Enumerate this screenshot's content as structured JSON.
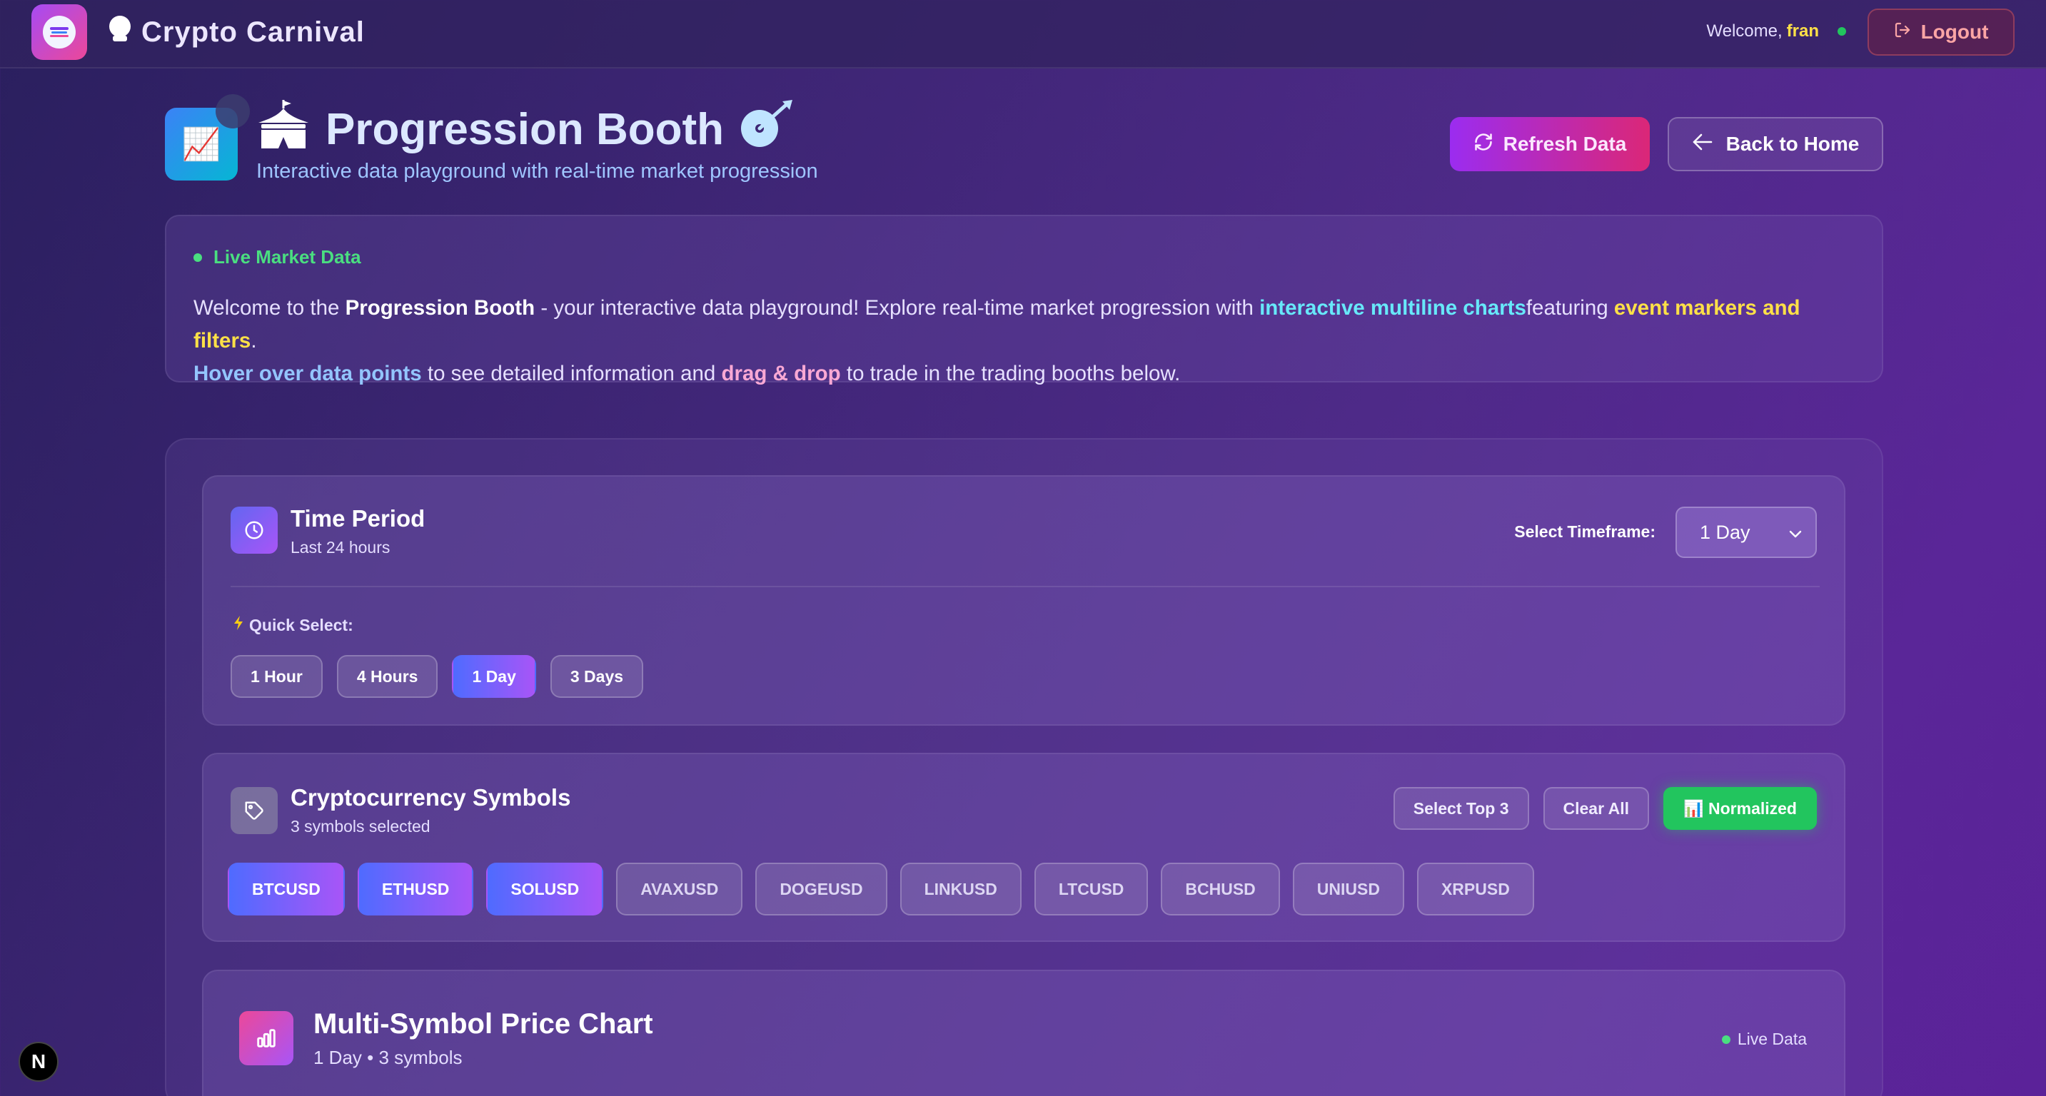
{
  "header": {
    "app_title": "Crypto Carnival",
    "welcome_prefix": "Welcome,",
    "username": "fran",
    "logout_label": "Logout"
  },
  "page": {
    "icon_emoji": "📈",
    "title": "Progression Booth",
    "subtitle": "Interactive data playground with real-time market progression",
    "refresh_label": "Refresh Data",
    "home_label": "Back to Home"
  },
  "intro": {
    "live_label": "Live Market Data",
    "seg1": "Welcome to the ",
    "seg2": "Progression Booth",
    "seg3": " - your interactive data playground! Explore real-time market progression with ",
    "seg4": "interactive multiline charts",
    "seg5": "featuring ",
    "seg6": "event markers and filters",
    "seg7": ". ",
    "seg8": "Hover over data points",
    "seg9": " to see detailed information and ",
    "seg10": "drag & drop",
    "seg11": " to trade in the trading booths below."
  },
  "time_period": {
    "title": "Time Period",
    "subtitle": "Last 24 hours",
    "select_label": "Select Timeframe:",
    "selected_value": "1 Day",
    "quick_label": "Quick Select:",
    "quick_options": [
      "1 Hour",
      "4 Hours",
      "1 Day",
      "3 Days"
    ],
    "active_option": "1 Day"
  },
  "symbols": {
    "title": "Cryptocurrency Symbols",
    "subtitle": "3 symbols selected",
    "select_top_label": "Select Top 3",
    "clear_label": "Clear All",
    "normalized_label": "📊 Normalized",
    "items": [
      "BTCUSD",
      "ETHUSD",
      "SOLUSD",
      "AVAXUSD",
      "DOGEUSD",
      "LINKUSD",
      "LTCUSD",
      "BCHUSD",
      "UNIUSD",
      "XRPUSD"
    ],
    "selected": [
      "BTCUSD",
      "ETHUSD",
      "SOLUSD"
    ]
  },
  "chart": {
    "title": "Multi-Symbol Price Chart",
    "subtitle": "1 Day • 3 symbols",
    "live_label": "Live Data"
  },
  "badge": {
    "letter": "N"
  },
  "colors": {
    "accent_purple": "#a855f7",
    "accent_blue": "#4f6bff",
    "live_green": "#4ade80",
    "logout_red": "#fca5a5",
    "username_yellow": "#fde047"
  }
}
